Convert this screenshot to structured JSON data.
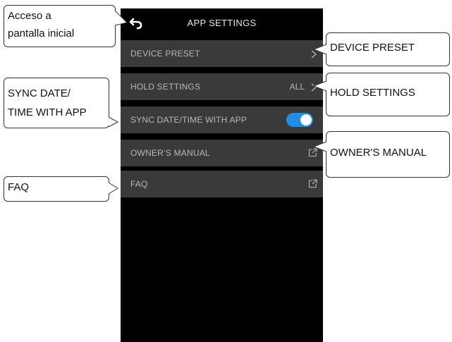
{
  "header": {
    "title": "APP SETTINGS",
    "back_icon": "back-arrow-icon"
  },
  "settings": {
    "device_preset": {
      "label": "DEVICE PRESET"
    },
    "hold_settings": {
      "label": "HOLD SETTINGS",
      "value": "ALL"
    },
    "sync_date_time": {
      "label": "SYNC DATE/TIME WITH APP",
      "enabled": true
    },
    "owners_manual": {
      "label": "OWNER’S MANUAL"
    },
    "faq": {
      "label": "FAQ"
    }
  },
  "callouts": {
    "home": {
      "line1": "Acceso a",
      "line2": "pantalla inicial"
    },
    "device_preset": "DEVICE PRESET",
    "hold_settings": "HOLD SETTINGS",
    "sync": {
      "line1": "SYNC DATE/",
      "line2": "TIME WITH APP"
    },
    "owners_manual": "OWNER'S MANUAL",
    "faq": "FAQ"
  },
  "colors": {
    "background": "#000000",
    "row": "#3a3a3a",
    "toggle_on": "#1e8fe8",
    "text": "#b8b8b8"
  }
}
